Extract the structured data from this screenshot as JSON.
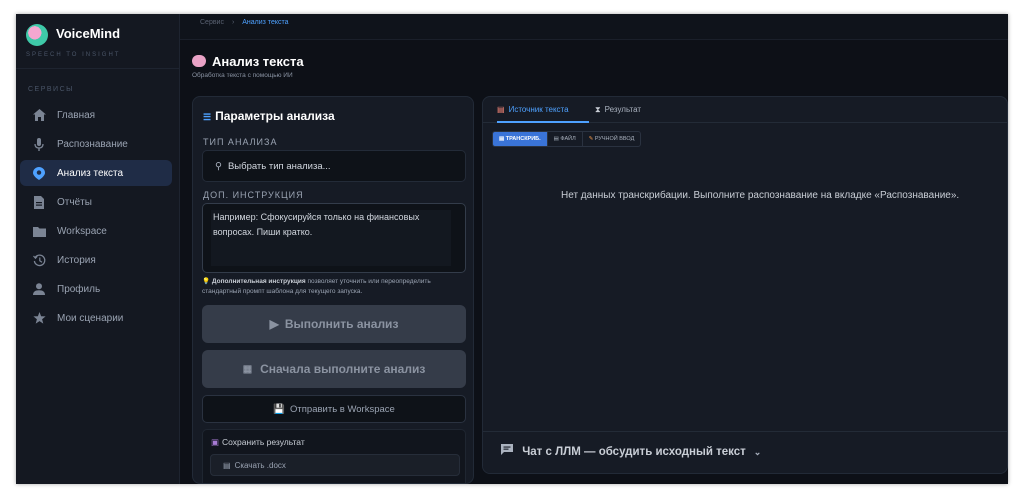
{
  "app": {
    "name": "VoiceMind",
    "tagline": "SPEECH TO INSIGHT"
  },
  "sidebar": {
    "section_label": "СЕРВИСЫ",
    "items": [
      {
        "label": "Главная",
        "icon": "home-icon"
      },
      {
        "label": "Распознавание",
        "icon": "microphone-icon"
      },
      {
        "label": "Анализ текста",
        "icon": "brain-icon",
        "active": true
      },
      {
        "label": "Отчёты",
        "icon": "document-icon"
      },
      {
        "label": "Workspace",
        "icon": "folder-icon"
      },
      {
        "label": "История",
        "icon": "history-icon"
      },
      {
        "label": "Профиль",
        "icon": "user-icon"
      },
      {
        "label": "Мои сценарии",
        "icon": "star-icon"
      }
    ]
  },
  "breadcrumb": {
    "parent": "Сервис",
    "separator": "›",
    "current": "Анализ текста"
  },
  "page": {
    "title": "Анализ текста",
    "subtitle": "Обработка текста с помощью ИИ"
  },
  "params": {
    "title": "Параметры анализа",
    "analysis_type_label": "ТИП АНАЛИЗА",
    "analysis_type_placeholder": "Выбрать тип анализа...",
    "instruction_label": "ДОП. ИНСТРУКЦИЯ",
    "instruction_placeholder": "Например: Сфокусируйся только на финансовых вопросах. Пиши кратко.",
    "hint_bold": "Дополнительная инструкция",
    "hint_rest": " позволяет уточнить или переопределить стандартный промпт шаблона для текущего запуска.",
    "run_button": "Выполнить анализ",
    "first_run_button": "Сначала выполните анализ",
    "send_workspace_button": "Отправить в Workspace",
    "save_title": "Сохранить результат",
    "download_docx": "Скачать .docx"
  },
  "source": {
    "tabs": [
      {
        "label": "Источник текста",
        "active": true
      },
      {
        "label": "Результат"
      }
    ],
    "subtabs": [
      {
        "label": "ТРАНСКРИБ.",
        "active": true
      },
      {
        "label": "ФАЙЛ"
      },
      {
        "label": "РУЧНОЙ ВВОД"
      }
    ],
    "empty_message": "Нет данных транскрибации. Выполните распознавание на вкладке «Распознавание».",
    "chat_label": "Чат с ЛЛМ — обсудить исходный текст"
  },
  "colors": {
    "accent": "#4ea1ff",
    "background": "#0d1017",
    "panel": "#161b25",
    "active_nav": "#1f2c46",
    "subtab_active": "#3a74d8"
  }
}
